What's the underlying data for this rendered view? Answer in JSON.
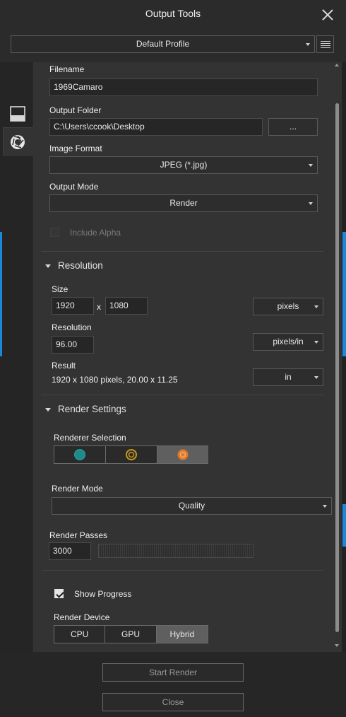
{
  "window": {
    "title": "Output Tools"
  },
  "profile": {
    "selected": "Default Profile"
  },
  "output": {
    "filename_label": "Filename",
    "filename_value": "1969Camaro",
    "folder_label": "Output Folder",
    "folder_value": "C:\\Users\\ccook\\Desktop",
    "browse_label": "...",
    "format_label": "Image Format",
    "format_value": "JPEG (*.jpg)",
    "mode_label": "Output Mode",
    "mode_value": "Render",
    "alpha_label": "Include Alpha",
    "alpha_checked": false
  },
  "resolution": {
    "section_title": "Resolution",
    "size_label": "Size",
    "width": "1920",
    "times": "x",
    "height": "1080",
    "size_unit": "pixels",
    "resolution_label": "Resolution",
    "resolution_value": "96.00",
    "resolution_unit": "pixels/in",
    "result_label": "Result",
    "result_value": "1920 x 1080 pixels, 20.00 x 11.25",
    "result_unit": "in"
  },
  "render_settings": {
    "section_title": "Render Settings",
    "renderer_label": "Renderer Selection",
    "renderers": [
      {
        "icon": "teal-renderer-icon",
        "color": "#1f8a8a",
        "selected": false
      },
      {
        "icon": "gold-renderer-icon",
        "color": "#c89a1a",
        "selected": false
      },
      {
        "icon": "orange-renderer-icon",
        "color": "#e07a2a",
        "selected": true
      }
    ],
    "mode_label": "Render Mode",
    "mode_value": "Quality",
    "passes_label": "Render Passes",
    "passes_value": "3000",
    "show_progress_label": "Show Progress",
    "show_progress_checked": true,
    "device_label": "Render Device",
    "devices": [
      "CPU",
      "GPU",
      "Hybrid"
    ],
    "selected_device": "Hybrid"
  },
  "actions": {
    "start_label": "Start Render",
    "close_label": "Close"
  },
  "colors": {
    "accent_blue": "#1c88d8",
    "panel": "#333333",
    "background": "#1e1e1e"
  }
}
